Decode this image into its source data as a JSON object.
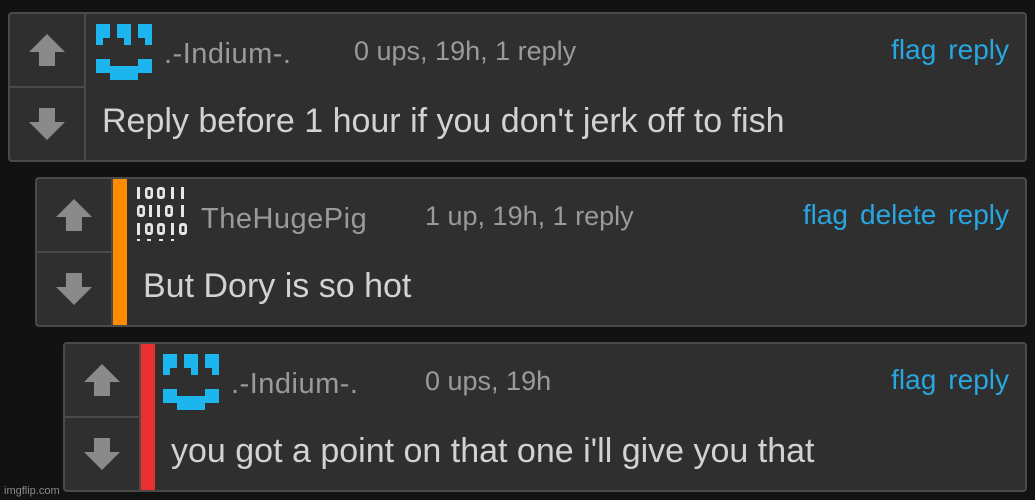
{
  "colors": {
    "background": "#121212",
    "panel": "#2f2f2f",
    "link": "#27a6e0",
    "meta_text": "#9a9a9a",
    "body_text": "#d2d2d2",
    "bar_orange": "#ff8c00",
    "bar_red": "#e83030"
  },
  "comments": [
    {
      "username": ".-Indium-.",
      "meta": "0 ups, 19h, 1 reply",
      "text": "Reply before 1 hour if you don't jerk off to fish",
      "actions": [
        "flag",
        "reply"
      ],
      "avatar_icon": "blue-pixel-face-icon"
    },
    {
      "username": "TheHugePig",
      "meta": "1 up, 19h, 1 reply",
      "text": "But Dory is so hot",
      "actions": [
        "flag",
        "delete",
        "reply"
      ],
      "avatar_icon": "binary-digits-icon",
      "bar_color": "#ff8c00"
    },
    {
      "username": ".-Indium-.",
      "meta": "0 ups, 19h",
      "text": "you got a point on that one i'll give you that",
      "actions": [
        "flag",
        "reply"
      ],
      "avatar_icon": "blue-pixel-face-icon",
      "bar_color": "#e83030"
    }
  ],
  "icons": {
    "upvote": "upvote-arrow-icon",
    "downvote": "downvote-arrow-icon"
  },
  "watermark": "imgflip.com"
}
